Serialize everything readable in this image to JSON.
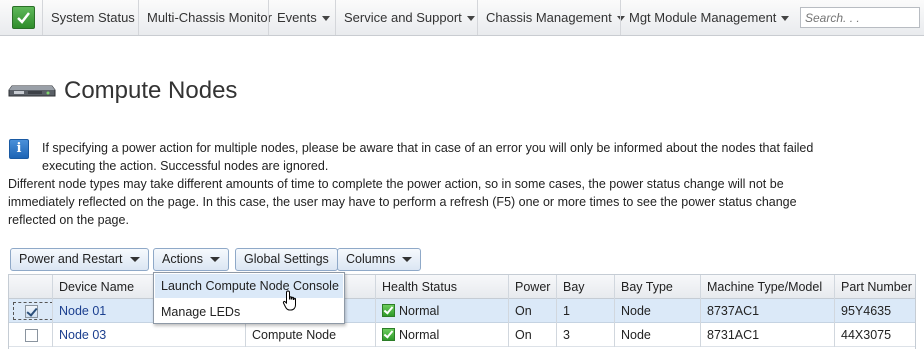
{
  "topnav": {
    "brand_icon": "green-check-icon",
    "items": [
      {
        "label": "System Status",
        "dropdown": false
      },
      {
        "label": "Multi-Chassis Monitor",
        "dropdown": false
      },
      {
        "label": "Events",
        "dropdown": true
      },
      {
        "label": "Service and Support",
        "dropdown": true
      },
      {
        "label": "Chassis Management",
        "dropdown": true
      },
      {
        "label": "Mgt Module Management",
        "dropdown": true
      }
    ],
    "search_placeholder": "Search. . ."
  },
  "page": {
    "title": "Compute Nodes",
    "title_icon": "chassis-icon"
  },
  "info": {
    "icon": "info-icon",
    "line1": "If specifying a power action for multiple nodes, please be aware that in case of an error you will only be informed about the nodes that failed executing the action. Successful nodes are ignored.",
    "line2": "Different node types may take different amounts of time to complete the power action, so in some cases, the power status change will not be immediately reflected on the page. In this case, the user may have to perform a refresh (F5) one or more times to see the power status change reflected on the page."
  },
  "toolbar": {
    "power_restart": "Power and Restart",
    "actions": "Actions",
    "global_settings": "Global Settings",
    "columns": "Columns"
  },
  "actions_menu": {
    "items": [
      "Launch Compute Node Console",
      "Manage LEDs"
    ]
  },
  "table": {
    "columns": [
      "Device Name",
      "",
      "Health Status",
      "Power",
      "Bay",
      "Bay Type",
      "Machine Type/Model",
      "Part Number"
    ],
    "rows": [
      {
        "checked": true,
        "device": "Node 01",
        "type": "",
        "health": "Normal",
        "power": "On",
        "bay": "1",
        "bay_type": "Node",
        "mtm": "8737AC1",
        "part": "95Y4635"
      },
      {
        "checked": false,
        "device": "Node 03",
        "type": "Compute Node",
        "health": "Normal",
        "power": "On",
        "bay": "3",
        "bay_type": "Node",
        "mtm": "8731AC1",
        "part": "44X3075"
      }
    ]
  },
  "colors": {
    "accent": "#1b3f8f",
    "selected_row": "#dbe9f8",
    "status_ok": "#2f9a2a"
  }
}
